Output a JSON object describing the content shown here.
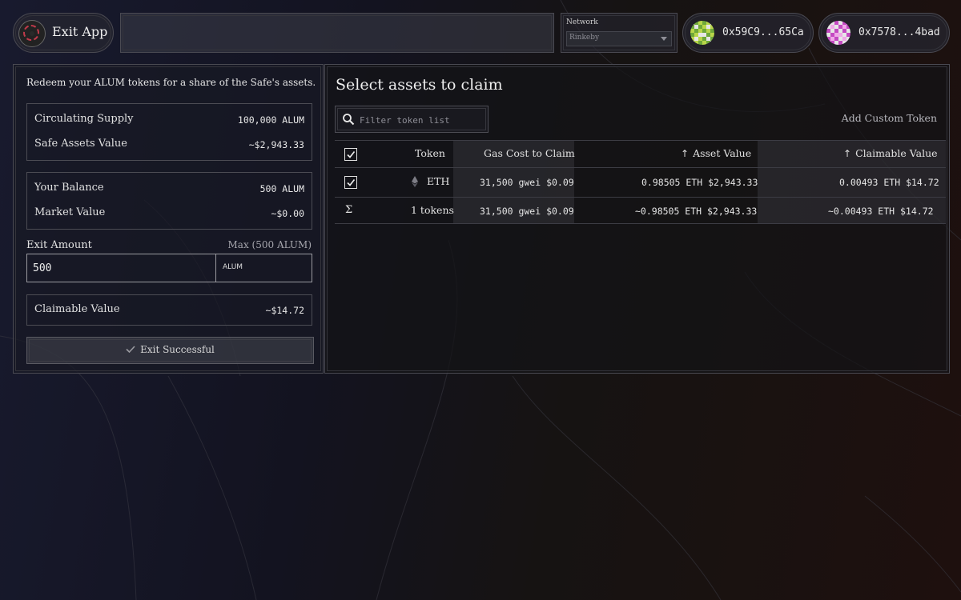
{
  "header": {
    "exit_app_label": "Exit App",
    "network": {
      "label": "Network",
      "selected": "Rinkeby"
    },
    "accounts": [
      {
        "address": "0x59C9...65Ca",
        "avatar_colors": [
          "#b8d64a",
          "#e6e6e6",
          "#6fa83a"
        ]
      },
      {
        "address": "0x7578...4bad",
        "avatar_colors": [
          "#c44ac2",
          "#f0a8e8",
          "#e6e6e6"
        ]
      }
    ]
  },
  "left": {
    "intro": "Redeem your ALUM tokens for a share of the Safe's assets.",
    "supply_box": {
      "circulating_supply_label": "Circulating Supply",
      "circulating_supply_value": "100,000 ALUM",
      "safe_assets_label": "Safe Assets Value",
      "safe_assets_value": "~$2,943.33"
    },
    "balance_box": {
      "your_balance_label": "Your Balance",
      "your_balance_value": "500 ALUM",
      "market_value_label": "Market Value",
      "market_value_value": "~$0.00"
    },
    "exit_amount_label": "Exit Amount",
    "max_label": "Max (500 ALUM)",
    "exit_amount_value": "500",
    "exit_amount_unit": "ALUM",
    "claimable_label": "Claimable Value",
    "claimable_value": "~$14.72",
    "exit_button_label": "Exit Successful"
  },
  "right": {
    "title": "Select assets to claim",
    "filter_placeholder": "Filter token list",
    "add_custom_token": "Add Custom Token",
    "columns": {
      "token": "Token",
      "gas": "Gas Cost to Claim",
      "asset_value": "Asset Value",
      "claimable_value": "Claimable Value"
    },
    "rows": [
      {
        "token": "ETH",
        "gas": "31,500 gwei $0.09",
        "asset_value": "0.98505 ETH $2,943.33",
        "claimable_value": "0.00493 ETH $14.72",
        "checked": true
      }
    ],
    "total": {
      "symbol": "Σ",
      "token": "1 tokens",
      "gas": "31,500 gwei $0.09",
      "asset_value": "~0.98505 ETH $2,943.33",
      "claimable_value": "~0.00493 ETH $14.72"
    }
  }
}
